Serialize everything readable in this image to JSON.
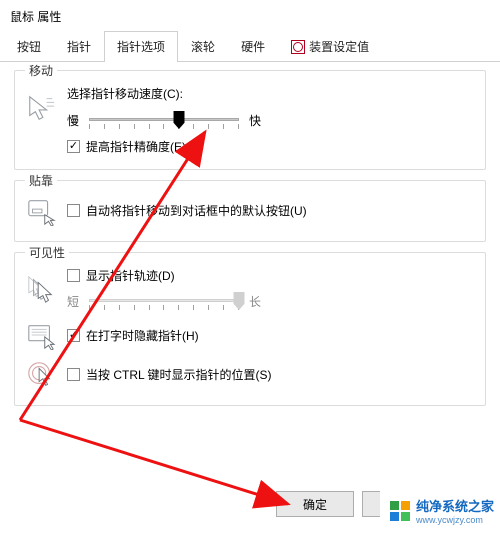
{
  "window": {
    "title": "鼠标 属性"
  },
  "tabs": {
    "items": [
      {
        "label": "按钮"
      },
      {
        "label": "指针"
      },
      {
        "label": "指针选项"
      },
      {
        "label": "滚轮"
      },
      {
        "label": "硬件"
      },
      {
        "label": "装置设定值"
      }
    ],
    "active_index": 2
  },
  "motion": {
    "title": "移动",
    "speed_label": "选择指针移动速度(C):",
    "slow": "慢",
    "fast": "快",
    "speed_value": 6,
    "speed_max": 10,
    "enhance_precision": {
      "label": "提高指针精确度(E)",
      "checked": true
    }
  },
  "snap": {
    "title": "贴靠",
    "auto_move": {
      "label": "自动将指针移动到对话框中的默认按钮(U)",
      "checked": false
    }
  },
  "visibility": {
    "title": "可见性",
    "trails": {
      "label": "显示指针轨迹(D)",
      "checked": false
    },
    "trail_short": "短",
    "trail_long": "长",
    "trail_value": 10,
    "trail_max": 10,
    "hide_typing": {
      "label": "在打字时隐藏指针(H)",
      "checked": true
    },
    "ctrl_locate": {
      "label": "当按 CTRL 键时显示指针的位置(S)",
      "checked": false
    }
  },
  "buttons": {
    "ok": "确定"
  },
  "watermark": {
    "text": "纯净系统之家",
    "url": "www.ycwjzy.com"
  }
}
